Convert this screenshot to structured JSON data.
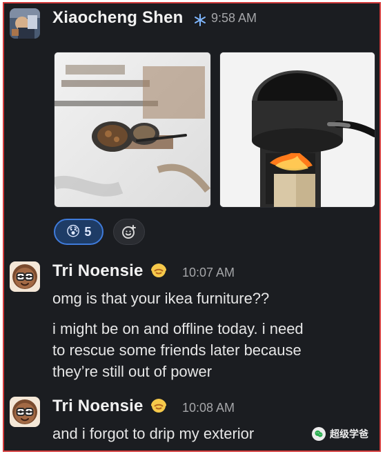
{
  "messages": [
    {
      "author": "Xiaocheng Shen",
      "status_icon": "snowflake-icon",
      "time": "9:58 AM",
      "attachments": [
        {
          "kind": "photo",
          "subject": "fire-and-pans-photo"
        },
        {
          "kind": "photo",
          "subject": "pot-on-fire-photo"
        }
      ],
      "reactions": [
        {
          "emoji": "😰",
          "count": "5"
        }
      ],
      "add_reaction_icon": "add-reaction-icon"
    },
    {
      "author": "Tri Noensie",
      "status_icon": "face-emoji-icon",
      "time": "10:07 AM",
      "lines": [
        "omg is that your ikea furniture??",
        "i might be on and offline today. i need",
        "to rescue some friends later because",
        "they’re still out of power"
      ]
    },
    {
      "author": "Tri Noensie",
      "status_icon": "face-emoji-icon",
      "time": "10:08 AM",
      "lines": [
        "and i forgot to drip my exterior"
      ]
    }
  ],
  "watermark": {
    "text": "超级学爸"
  },
  "colors": {
    "background": "#1b1d21",
    "frame": "#d23a3a",
    "reaction_bg": "#1e3c66",
    "reaction_border": "#3f7bdb"
  }
}
